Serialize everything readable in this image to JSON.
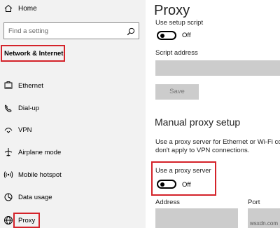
{
  "sidebar": {
    "home_label": "Home",
    "search_placeholder": "Find a setting",
    "section_label": "Network & Internet",
    "items": [
      {
        "label": "Ethernet",
        "icon": "ethernet-icon"
      },
      {
        "label": "Dial-up",
        "icon": "dialup-icon"
      },
      {
        "label": "VPN",
        "icon": "vpn-icon"
      },
      {
        "label": "Airplane mode",
        "icon": "airplane-icon"
      },
      {
        "label": "Mobile hotspot",
        "icon": "hotspot-icon"
      },
      {
        "label": "Data usage",
        "icon": "data-usage-icon"
      },
      {
        "label": "Proxy",
        "icon": "globe-icon"
      }
    ]
  },
  "main": {
    "title": "Proxy",
    "setup_script_label": "Use setup script",
    "setup_script_state": "Off",
    "script_address_label": "Script address",
    "script_address_value": "",
    "save_label": "Save",
    "manual_title": "Manual proxy setup",
    "manual_desc_line1": "Use a proxy server for Ethernet or Wi-Fi con",
    "manual_desc_line2": "don't apply to VPN connections.",
    "proxy_server_label": "Use a proxy server",
    "proxy_server_state": "Off",
    "address_label": "Address",
    "port_label": "Port"
  },
  "watermark": "wsxdn.com",
  "colors": {
    "highlight": "#d4232a",
    "sidebar_bg": "#f2f2f2",
    "field_bg": "#cccccc"
  }
}
